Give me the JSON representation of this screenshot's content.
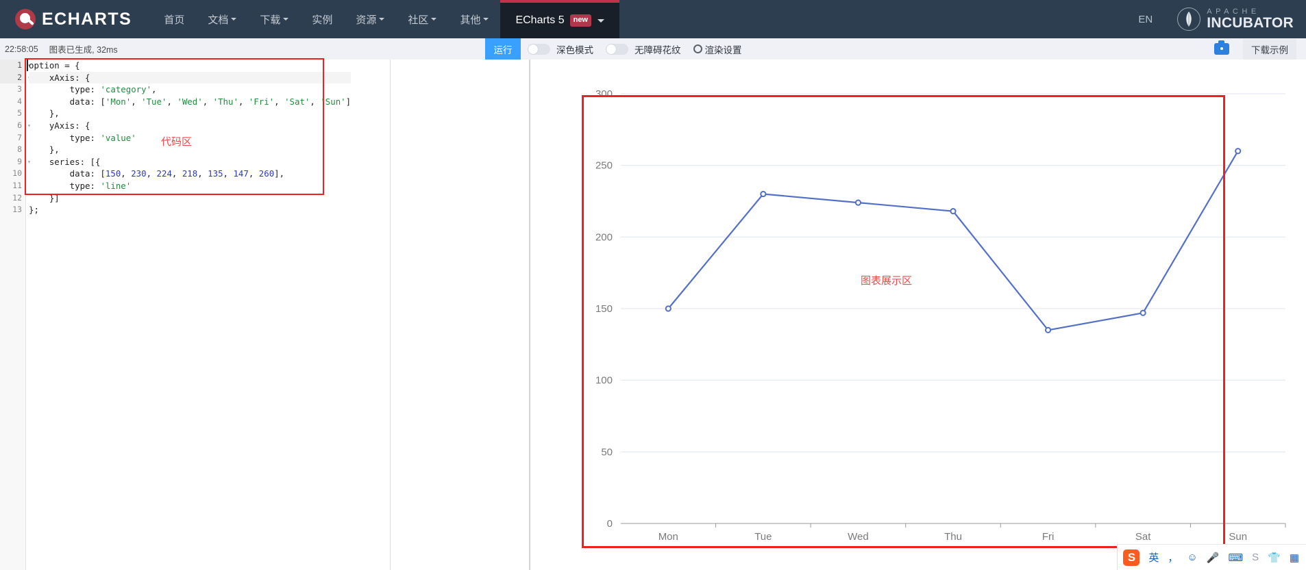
{
  "nav": {
    "brand": "ECHARTS",
    "links": [
      {
        "label": "首页",
        "caret": false
      },
      {
        "label": "文档",
        "caret": true
      },
      {
        "label": "下载",
        "caret": true
      },
      {
        "label": "实例",
        "caret": false
      },
      {
        "label": "资源",
        "caret": true
      },
      {
        "label": "社区",
        "caret": true
      },
      {
        "label": "其他",
        "caret": true
      }
    ],
    "active_tab": "ECharts 5",
    "active_badge": "new",
    "lang": "EN",
    "incubator_top": "APACHE",
    "incubator_bottom": "INCUBATOR"
  },
  "toolbar": {
    "timestamp": "22:58:05",
    "status": "图表已生成, 32ms",
    "run_label": "运行",
    "dark_mode_label": "深色模式",
    "accessibility_label": "无障碍花纹",
    "render_settings_label": "渲染设置",
    "download_label": "下载示例"
  },
  "editor": {
    "line_numbers": [
      "1",
      "2",
      "3",
      "4",
      "5",
      "6",
      "7",
      "8",
      "9",
      "10",
      "11",
      "12",
      "13"
    ],
    "fold_lines": [
      1,
      2,
      6,
      9
    ],
    "highlight_lines": [
      1,
      2
    ],
    "lines": [
      [
        {
          "t": "option = {",
          "c": ""
        }
      ],
      [
        {
          "t": "    xAxis: {",
          "c": ""
        }
      ],
      [
        {
          "t": "        type: ",
          "c": ""
        },
        {
          "t": "'category'",
          "c": "tok-str"
        },
        {
          "t": ",",
          "c": ""
        }
      ],
      [
        {
          "t": "        data: [",
          "c": ""
        },
        {
          "t": "'Mon'",
          "c": "tok-str"
        },
        {
          "t": ", ",
          "c": ""
        },
        {
          "t": "'Tue'",
          "c": "tok-str"
        },
        {
          "t": ", ",
          "c": ""
        },
        {
          "t": "'Wed'",
          "c": "tok-str"
        },
        {
          "t": ", ",
          "c": ""
        },
        {
          "t": "'Thu'",
          "c": "tok-str"
        },
        {
          "t": ", ",
          "c": ""
        },
        {
          "t": "'Fri'",
          "c": "tok-str"
        },
        {
          "t": ", ",
          "c": ""
        },
        {
          "t": "'Sat'",
          "c": "tok-str"
        },
        {
          "t": ", ",
          "c": ""
        },
        {
          "t": "'Sun'",
          "c": "tok-str"
        },
        {
          "t": "]",
          "c": ""
        }
      ],
      [
        {
          "t": "    },",
          "c": ""
        }
      ],
      [
        {
          "t": "    yAxis: {",
          "c": ""
        }
      ],
      [
        {
          "t": "        type: ",
          "c": ""
        },
        {
          "t": "'value'",
          "c": "tok-str"
        }
      ],
      [
        {
          "t": "    },",
          "c": ""
        }
      ],
      [
        {
          "t": "    series: [{",
          "c": ""
        }
      ],
      [
        {
          "t": "        data: [",
          "c": ""
        },
        {
          "t": "150",
          "c": "tok-num"
        },
        {
          "t": ", ",
          "c": ""
        },
        {
          "t": "230",
          "c": "tok-num"
        },
        {
          "t": ", ",
          "c": ""
        },
        {
          "t": "224",
          "c": "tok-num"
        },
        {
          "t": ", ",
          "c": ""
        },
        {
          "t": "218",
          "c": "tok-num"
        },
        {
          "t": ", ",
          "c": ""
        },
        {
          "t": "135",
          "c": "tok-num"
        },
        {
          "t": ", ",
          "c": ""
        },
        {
          "t": "147",
          "c": "tok-num"
        },
        {
          "t": ", ",
          "c": ""
        },
        {
          "t": "260",
          "c": "tok-num"
        },
        {
          "t": "],",
          "c": ""
        }
      ],
      [
        {
          "t": "        type: ",
          "c": ""
        },
        {
          "t": "'line'",
          "c": "tok-str"
        }
      ],
      [
        {
          "t": "    }]",
          "c": ""
        }
      ],
      [
        {
          "t": "};",
          "c": ""
        }
      ]
    ],
    "annotation": "代码区"
  },
  "chart_annotation": "图表展示区",
  "chart_data": {
    "type": "line",
    "title": "",
    "xlabel": "",
    "ylabel": "",
    "categories": [
      "Mon",
      "Tue",
      "Wed",
      "Thu",
      "Fri",
      "Sat",
      "Sun"
    ],
    "values": [
      150,
      230,
      224,
      218,
      135,
      147,
      260
    ],
    "ylim": [
      0,
      300
    ],
    "yticks": [
      0,
      50,
      100,
      150,
      200,
      250,
      300
    ],
    "grid": true,
    "legend": "none",
    "series_color": "#5470c6",
    "symbol": "circle"
  },
  "ime": {
    "logo": "S",
    "mode": "英",
    "items": [
      "，",
      "☺",
      "🎤",
      "⌨",
      "S",
      "👕",
      "▦"
    ]
  },
  "colors": {
    "nav_bg": "#2c3e50",
    "accent_red": "#c0344b",
    "run_blue": "#3aa0ff",
    "annotation_red": "#f04a4a",
    "line_blue": "#5470c6"
  }
}
